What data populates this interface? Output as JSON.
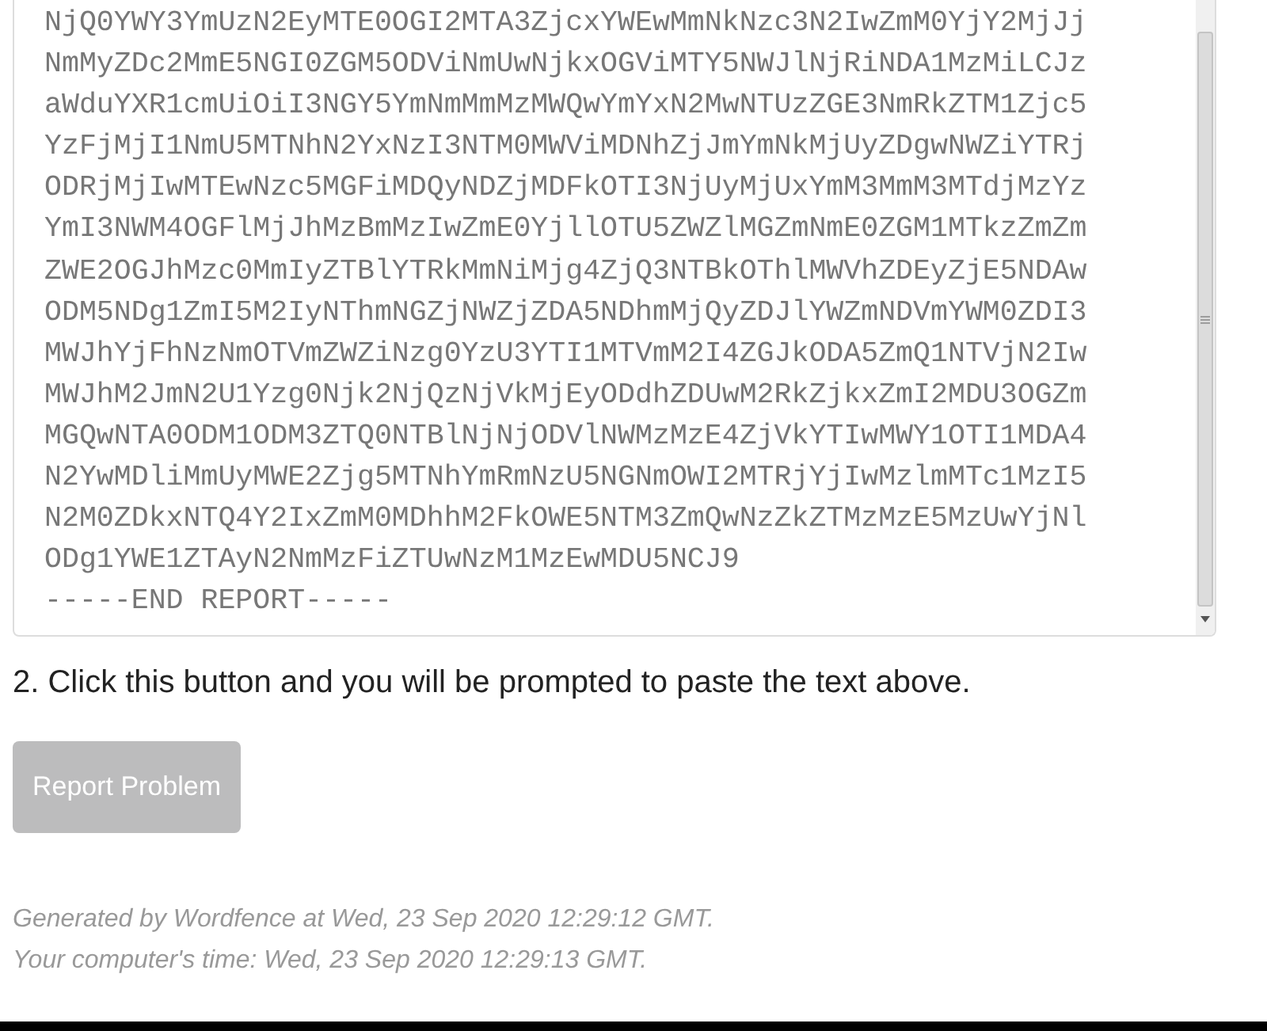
{
  "report": {
    "lines": [
      "NjQ0YWY3YmUzN2EyMTE0OGI2MTA3ZjcxYWEwMmNkNzc3N2IwZmM0YjY2MjJj",
      "NmMyZDc2MmE5NGI0ZGM5ODViNmUwNjkxOGViMTY5NWJlNjRiNDA1MzMiLCJz",
      "aWduYXR1cmUiOiI3NGY5YmNmMmMzMWQwYmYxN2MwNTUzZGE3NmRkZTM1Zjc5",
      "YzFjMjI1NmU5MTNhN2YxNzI3NTM0MWViMDNhZjJmYmNkMjUyZDgwNWZiYTRj",
      "ODRjMjIwMTEwNzc5MGFiMDQyNDZjMDFkOTI3NjUyMjUxYmM3MmM3MTdjMzYz",
      "YmI3NWM4OGFlMjJhMzBmMzIwZmE0YjllOTU5ZWZlMGZmNmE0ZGM1MTkzZmZm",
      "ZWE2OGJhMzc0MmIyZTBlYTRkMmNiMjg4ZjQ3NTBkOThlMWVhZDEyZjE5NDAw",
      "ODM5NDg1ZmI5M2IyNThmNGZjNWZjZDA5NDhmMjQyZDJlYWZmNDVmYWM0ZDI3",
      "MWJhYjFhNzNmOTVmZWZiNzg0YzU3YTI1MTVmM2I4ZGJkODA5ZmQ1NTVjN2Iw",
      "MWJhM2JmN2U1Yzg0Njk2NjQzNjVkMjEyODdhZDUwM2RkZjkxZmI2MDU3OGZm",
      "MGQwNTA0ODM1ODM3ZTQ0NTBlNjNjODVlNWMzMzE4ZjVkYTIwMWY1OTI1MDA4",
      "N2YwMDliMmUyMWE2Zjg5MTNhYmRmNzU5NGNmOWI2MTRjYjIwMzlmMTc1MzI5",
      "N2M0ZDkxNTQ4Y2IxZmM0MDhhM2FkOWE5NTM3ZmQwNzZkZTMzMzE5MzUwYjNl",
      "ODg1YWE1ZTAyN2NmMzFiZTUwNzM1MzEwMDU5NCJ9",
      "-----END REPORT-----"
    ]
  },
  "instruction": "2. Click this button and you will be prompted to paste the text above.",
  "button": {
    "label": "Report Problem",
    "disabled": true
  },
  "footer": [
    "Generated by Wordfence at Wed, 23 Sep 2020 12:29:12 GMT.",
    "Your computer's time: Wed, 23 Sep 2020 12:29:13 GMT."
  ]
}
